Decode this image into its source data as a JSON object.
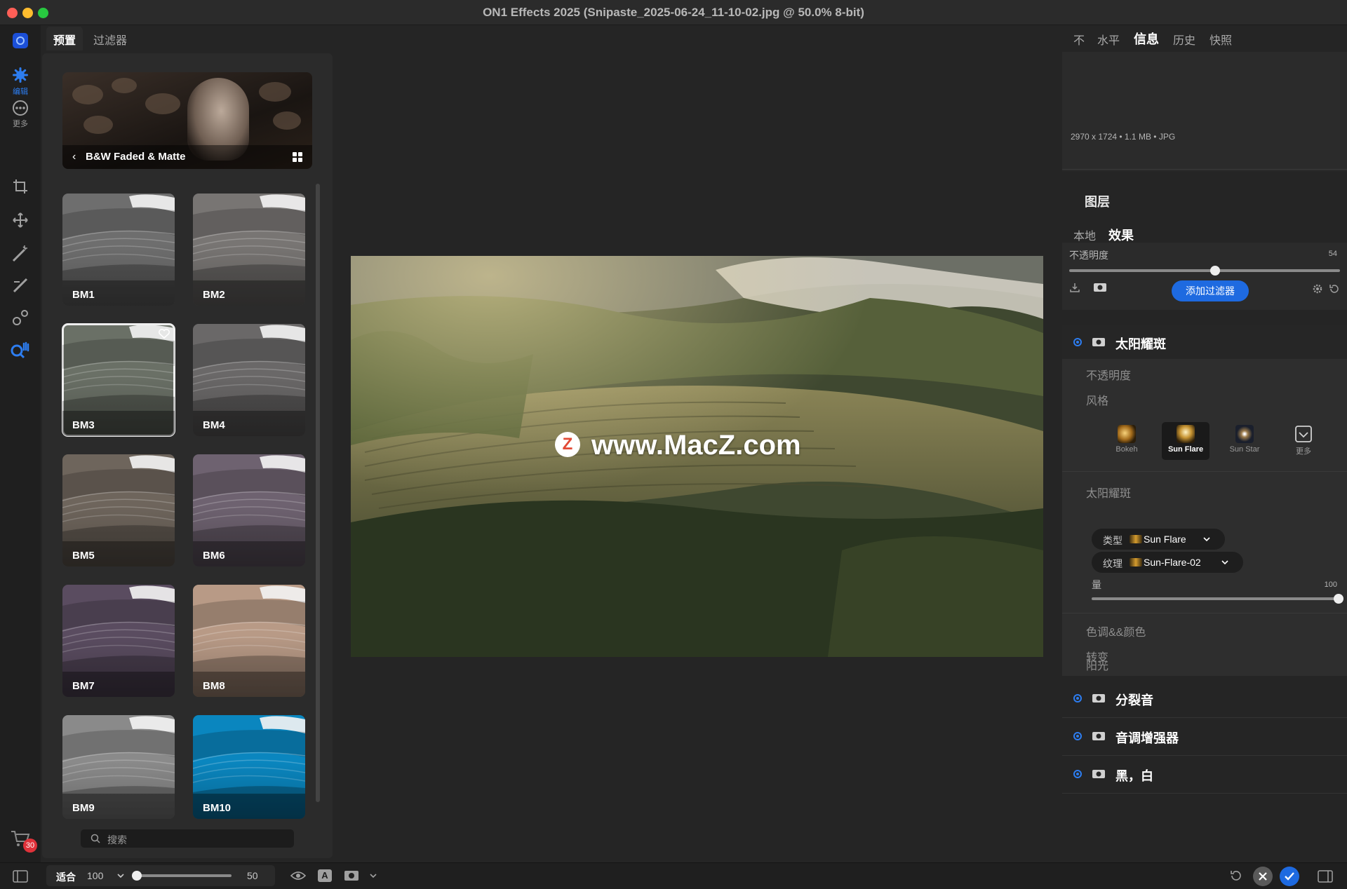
{
  "window": {
    "title": "ON1 Effects 2025 (Snipaste_2025-06-24_11-10-02.jpg @ 50.0% 8-bit)"
  },
  "left_tools": {
    "edit_label": "编辑",
    "more_label": "更多",
    "cart_badge": "30"
  },
  "presets_panel": {
    "tabs": [
      {
        "label": "预置",
        "active": true
      },
      {
        "label": "过滤器",
        "active": false
      }
    ],
    "category": {
      "name": "B&W Faded & Matte",
      "back_glyph": "‹"
    },
    "thumbnails": [
      {
        "label": "BM1",
        "selected": false,
        "tint": "#6e6e6e"
      },
      {
        "label": "BM2",
        "selected": false,
        "tint": "#787573"
      },
      {
        "label": "BM3",
        "selected": true,
        "tint": "#6a7066"
      },
      {
        "label": "BM4",
        "selected": false,
        "tint": "#6a6868"
      },
      {
        "label": "BM5",
        "selected": false,
        "tint": "#6e655c"
      },
      {
        "label": "BM6",
        "selected": false,
        "tint": "#6e6270"
      },
      {
        "label": "BM7",
        "selected": false,
        "tint": "#5a4c60"
      },
      {
        "label": "BM8",
        "selected": false,
        "tint": "#b89a86"
      },
      {
        "label": "BM9",
        "selected": false,
        "tint": "#8a8a8a"
      },
      {
        "label": "BM10",
        "selected": false,
        "tint": "#0a86bf"
      }
    ],
    "search_placeholder": "搜索"
  },
  "canvas": {
    "watermark": "www.MacZ.com",
    "watermark_logo": "Z"
  },
  "right_panel": {
    "tabs": [
      {
        "label": "不",
        "active": false
      },
      {
        "label": "水平",
        "active": false
      },
      {
        "label": "信息",
        "active": true
      },
      {
        "label": "历史",
        "active": false
      },
      {
        "label": "快照",
        "active": false
      }
    ],
    "info_line": "2970 x 1724 • 1.1 MB • JPG",
    "layers_heading": "图层",
    "effect_tabs": [
      {
        "label": "本地",
        "active": false
      },
      {
        "label": "效果",
        "active": true
      }
    ],
    "opacity_label": "不透明度",
    "opacity_value": "54",
    "add_filter_label": "添加过滤器",
    "sun_flare": {
      "name": "太阳耀斑",
      "sub_opacity": "不透明度",
      "style_label": "风格",
      "styles": [
        {
          "label": "Bokeh",
          "selected": false
        },
        {
          "label": "Sun Flare",
          "selected": true
        },
        {
          "label": "Sun Star",
          "selected": false
        },
        {
          "label": "更多",
          "selected": false
        }
      ],
      "section_label": "太阳耀斑",
      "type_label": "类型",
      "type_value": "Sun Flare",
      "texture_label": "纹理",
      "texture_value": "Sun-Flare-02",
      "amount_label": "量",
      "amount_value": "100",
      "tone_label": "色调&&颜色",
      "transform_label": "转变",
      "sunlight_label": "阳光"
    },
    "other_filters": [
      {
        "name": "分裂音"
      },
      {
        "name": "音调增强器"
      },
      {
        "name": "黑，白"
      }
    ]
  },
  "bottom_bar": {
    "fit_label": "适合",
    "zoom_value": "100",
    "slider_value": "50"
  },
  "colors": {
    "accent": "#2d7df0",
    "button_blue": "#1e6ae0",
    "panel": "#2b2b2b",
    "background": "#252525"
  }
}
